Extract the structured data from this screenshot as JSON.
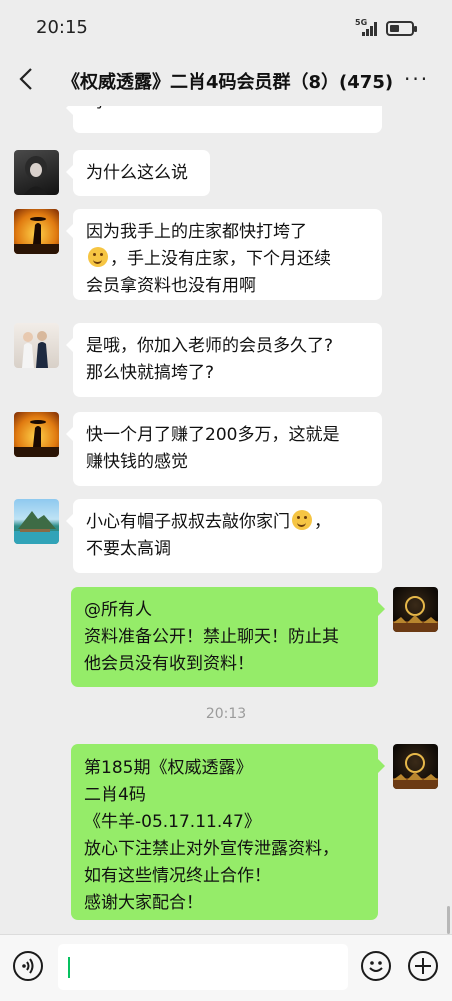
{
  "status_bar": {
    "time": "20:15",
    "network": "5G",
    "signal_icon": "signal-icon",
    "battery_icon": "battery-icon",
    "battery_level": 0.45
  },
  "header": {
    "title": "《权威透露》二肖4码会员群（8）(475)",
    "back_icon": "back-arrow-icon",
    "more_icon": "more-dots-icon",
    "more_label": "···"
  },
  "messages": [
    {
      "side": "left",
      "text": "吗"
    },
    {
      "side": "left",
      "text": "为什么这么说"
    },
    {
      "side": "left",
      "text": "因为我手上的庄家都快打垮了",
      "emoji": "facepalm-emoji",
      "text2": "，手上没有庄家，下个月还续",
      "text3": "会员拿资料也没有用啊"
    },
    {
      "side": "left",
      "text": "是哦，你加入老师的会员多久了?",
      "text2": "那么快就搞垮了?"
    },
    {
      "side": "left",
      "text": "快一个月了赚了200多万，这就是",
      "text2": "赚快钱的感觉"
    },
    {
      "side": "left",
      "text": "小心有帽子叔叔去敲你家门",
      "emoji": "thinking-emoji",
      "text2": "，",
      "text3": "不要太高调"
    },
    {
      "side": "right",
      "text": "@所有人",
      "text2": "资料准备公开！禁止聊天！防止其",
      "text3": "他会员没有收到资料！"
    },
    {
      "side": "right",
      "text": "第185期《权威透露》",
      "text2": "二肖4码",
      "text3": "《牛羊-05.17.11.47》",
      "text4": "放心下注禁止对外宣传泄露资料，",
      "text5": "如有这些情况终止合作！",
      "text6": "感谢大家配合！"
    }
  ],
  "timestamp": "20:13",
  "input_bar": {
    "voice_icon": "voice-icon",
    "emoji_icon": "emoji-icon",
    "plus_icon": "plus-icon",
    "value": ""
  },
  "colors": {
    "background": "#ededed",
    "sent_bubble": "#95ec69",
    "received_bubble": "#ffffff",
    "caret": "#07c160"
  }
}
